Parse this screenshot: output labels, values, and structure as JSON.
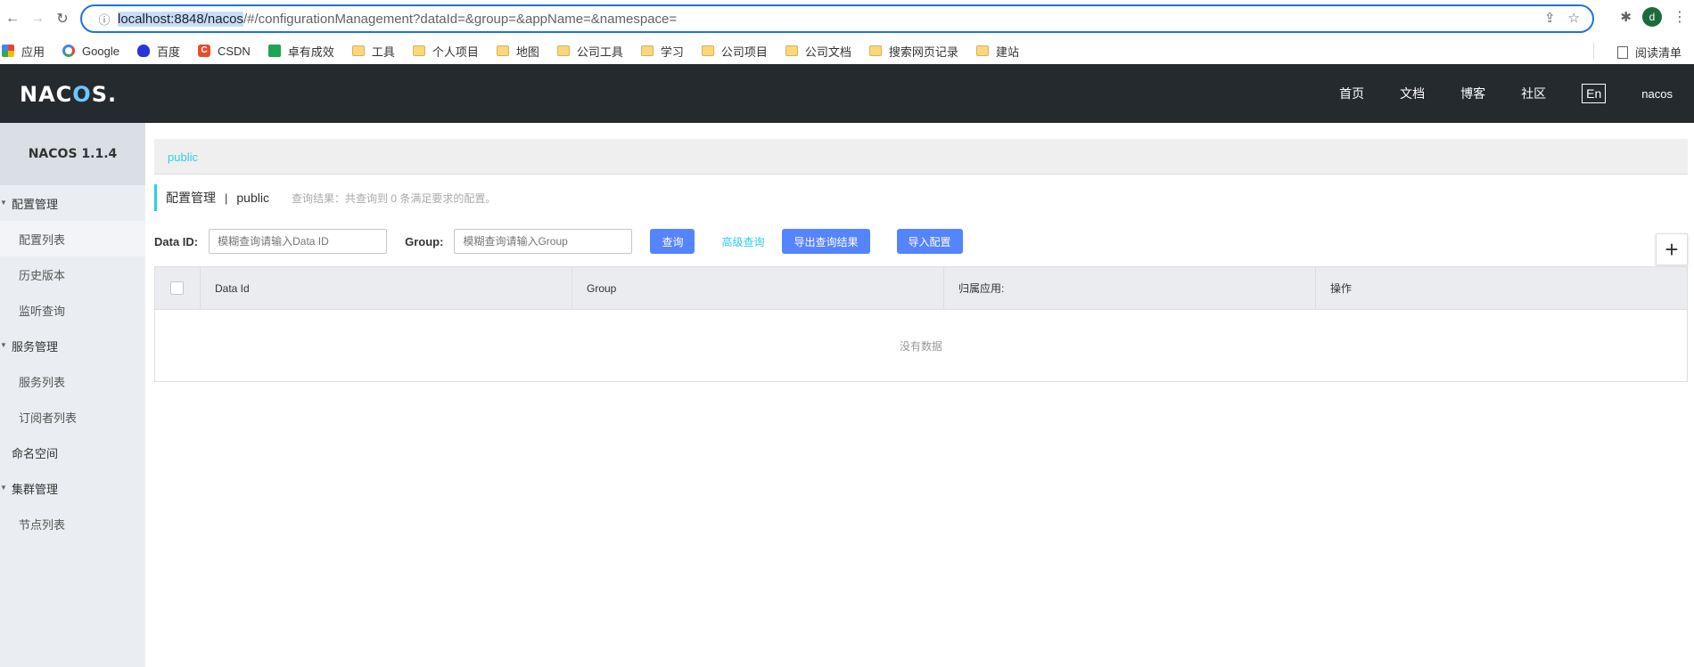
{
  "browser": {
    "url_selected": "localhost:8848/nacos",
    "url_rest": "/#/configurationManagement?dataId=&group=&appName=&namespace=",
    "avatar_letter": "d"
  },
  "bookmarks": {
    "items": [
      {
        "label": "应用",
        "icon": "apps-grid-icon"
      },
      {
        "label": "Google",
        "icon": "google-icon"
      },
      {
        "label": "百度",
        "icon": "baidu-icon"
      },
      {
        "label": "CSDN",
        "icon": "csdn-icon"
      },
      {
        "label": "卓有成效",
        "icon": "green-square-icon"
      },
      {
        "label": "工具",
        "icon": "folder-icon"
      },
      {
        "label": "个人项目",
        "icon": "folder-icon"
      },
      {
        "label": "地图",
        "icon": "folder-icon"
      },
      {
        "label": "公司工具",
        "icon": "folder-icon"
      },
      {
        "label": "学习",
        "icon": "folder-icon"
      },
      {
        "label": "公司项目",
        "icon": "folder-icon"
      },
      {
        "label": "公司文档",
        "icon": "folder-icon"
      },
      {
        "label": "搜索网页记录",
        "icon": "folder-icon"
      },
      {
        "label": "建站",
        "icon": "folder-icon"
      }
    ],
    "reading_list": "阅读清单",
    "csdn_glyph": "C"
  },
  "header": {
    "logo_left": "NAC",
    "logo_o": "O",
    "logo_right": "S.",
    "nav": [
      "首页",
      "文档",
      "博客",
      "社区"
    ],
    "lang": "En",
    "user": "nacos"
  },
  "sidebar": {
    "version": "NACOS 1.1.4",
    "config_group": "配置管理",
    "config_items": [
      "配置列表",
      "历史版本",
      "监听查询"
    ],
    "service_group": "服务管理",
    "service_items": [
      "服务列表",
      "订阅者列表"
    ],
    "namespace": "命名空间",
    "cluster_group": "集群管理",
    "cluster_items": [
      "节点列表"
    ]
  },
  "main": {
    "namespace_link": "public",
    "title": "配置管理",
    "title_sep": "|",
    "title_ns": "public",
    "result_hint": "查询结果：共查询到 0 条满足要求的配置。",
    "filter": {
      "data_id_label": "Data ID:",
      "data_id_placeholder": "模糊查询请输入Data ID",
      "group_label": "Group:",
      "group_placeholder": "模糊查询请输入Group",
      "query_btn": "查询",
      "advanced_btn": "高级查询",
      "export_btn": "导出查询结果",
      "import_btn": "导入配置"
    },
    "table": {
      "columns": [
        "Data Id",
        "Group",
        "归属应用:",
        "操作"
      ],
      "empty": "没有数据"
    }
  },
  "colors": {
    "header_bg": "#252a2f",
    "accent": "#33cde5",
    "primary": "#5584ff",
    "sidebar_bg": "#eaedf1"
  }
}
